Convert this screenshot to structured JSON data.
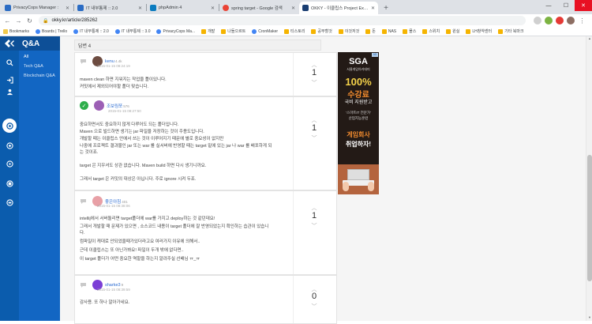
{
  "browser": {
    "tabs": [
      {
        "title": "PrivacyCops Manager :",
        "fav_color": "#2b6cc4",
        "active": false
      },
      {
        "title": "IT 내부통제 :: 2.0",
        "fav_color": "#2b6cc4",
        "active": false
      },
      {
        "title": "phpAdmin 4",
        "fav_color": "#0a7bbf",
        "active": false
      },
      {
        "title": "spring target - Google 검색",
        "fav_color": "#ea4335",
        "active": false
      },
      {
        "title": "OKKY - 이클립스 Project Explo",
        "fav_color": "#1a3e72",
        "active": true
      }
    ],
    "new_tab": "+",
    "window_controls": {
      "minimize": "—",
      "maximize": "☐",
      "close": "✕"
    },
    "url": "okky.kr/article/285262",
    "bookmarks": [
      {
        "label": "Bookmarks",
        "kind": "star"
      },
      {
        "label": "Boards | Trello",
        "kind": "site"
      },
      {
        "label": "IT 내부통제 :: 2.0",
        "kind": "site"
      },
      {
        "label": "IT 내부통제 :: 3.0",
        "kind": "site"
      },
      {
        "label": "PrivacyCops Ma...",
        "kind": "site"
      },
      {
        "label": "개발",
        "kind": "folder"
      },
      {
        "label": "나들으르트",
        "kind": "folder"
      },
      {
        "label": "CronMaker",
        "kind": "site"
      },
      {
        "label": "티스토리",
        "kind": "folder"
      },
      {
        "label": "공부할것",
        "kind": "folder"
      },
      {
        "label": "이것저것",
        "kind": "folder"
      },
      {
        "label": "돈",
        "kind": "folder"
      },
      {
        "label": "NAS",
        "kind": "folder"
      },
      {
        "label": "몰스",
        "kind": "folder"
      },
      {
        "label": "스위치",
        "kind": "folder"
      },
      {
        "label": "윈실",
        "kind": "folder"
      },
      {
        "label": "LH창약센터",
        "kind": "folder"
      },
      {
        "label": "기타 북마크",
        "kind": "folder"
      }
    ]
  },
  "site": {
    "logo": "Q&A",
    "menu": [
      "All",
      "Tech Q&A",
      "Blockchain Q&A"
    ],
    "menu_active_index": 0,
    "side_icons": [
      "search-icon",
      "login-icon",
      "user-icon",
      "qna-icon",
      "tech-icon",
      "community-icon",
      "column-icon",
      "jobs-icon"
    ]
  },
  "answers": {
    "header": "답변 4",
    "items": [
      {
        "author": "kenu",
        "score": "4.4k",
        "date": "2015-01-15 08:24:19",
        "accepted": false,
        "votes": "1",
        "avatar_color": "#6d4c41",
        "lines": [
          "maven clean 하면 지워지는 작업을 틀이있니다.",
          "커밋에서 제외되어야할 폴더 맞습니다."
        ]
      },
      {
        "author": "조보링쪼",
        "score": "576",
        "date": "2015-01-15 08:27:50",
        "accepted": true,
        "votes": "1",
        "avatar_color": "#9c5fb5",
        "lines": [
          "중요하면서도 중요하지 않게 다루어도 되는 폴더입니다.",
          "Maven 으로 빌드하면 생기는 jar 파일을 저장하는 것이 주용도입니다.",
          "개발할 때는 이클립스 안에서 쓰는 것이 이루어지기 때문에 별로 중요성이 없지만",
          "나중에 프로젝트 결과물인 jar 또는 war 를 실서버에 반영할 때는 target 밑에 있는 jar 나 war 를 배포하게 되",
          "는 것이죠.",
          "",
          "target 은 지우셔도 상관 없습니다. Maven build 하면 다시 생기니까요.",
          "",
          "그래서 target 은 커밋의 대상은 아닙니다. 주로 ignore 시켜 두죠."
        ]
      },
      {
        "author": "좋은아침",
        "score": "401",
        "date": "2015-01-15 08:38:06",
        "accepted": false,
        "votes": "1",
        "avatar_color": "#e8a0a6",
        "lines": [
          "intellij에서 서버돌리면 target폴더에 war를 가지고 deploy하는 것 같던데요!",
          "그래서 개발할 때 문제가 있으면 , 소스코드 내용이 target 폴더에 잘 반영되었는지 확인하는 습관이 있습니",
          "다.",
          "컴파일이 캐대로 안되었을때가있더라고요 여러가지 이유에 의해서..",
          "근데 이클립스는 또 아닌가봐요! 파일이 두개 밖에 없다면..",
          "이 target 폴더가 어떤 중요한 역할을 하는지 알려주실 선배님 ㅠ_ㅠ"
        ]
      },
      {
        "author": "sharke3",
        "score": "9",
        "date": "2015-01-15 08:39:59",
        "accepted": false,
        "votes": "0",
        "avatar_color": "#7b3fd6",
        "lines": [
          "감사용. 또 하나 알아가네요."
        ]
      }
    ]
  },
  "ad": {
    "brand": "SGA",
    "sub": "서울게임아카데미",
    "big": "100%",
    "big2": "수강료",
    "big3": "국비 지원받고",
    "line1": "'스마트IT 전문가'",
    "line2": "산업지능훈련",
    "headline1": "게임회사",
    "headline2": "취업하자!",
    "badge": "AD"
  }
}
